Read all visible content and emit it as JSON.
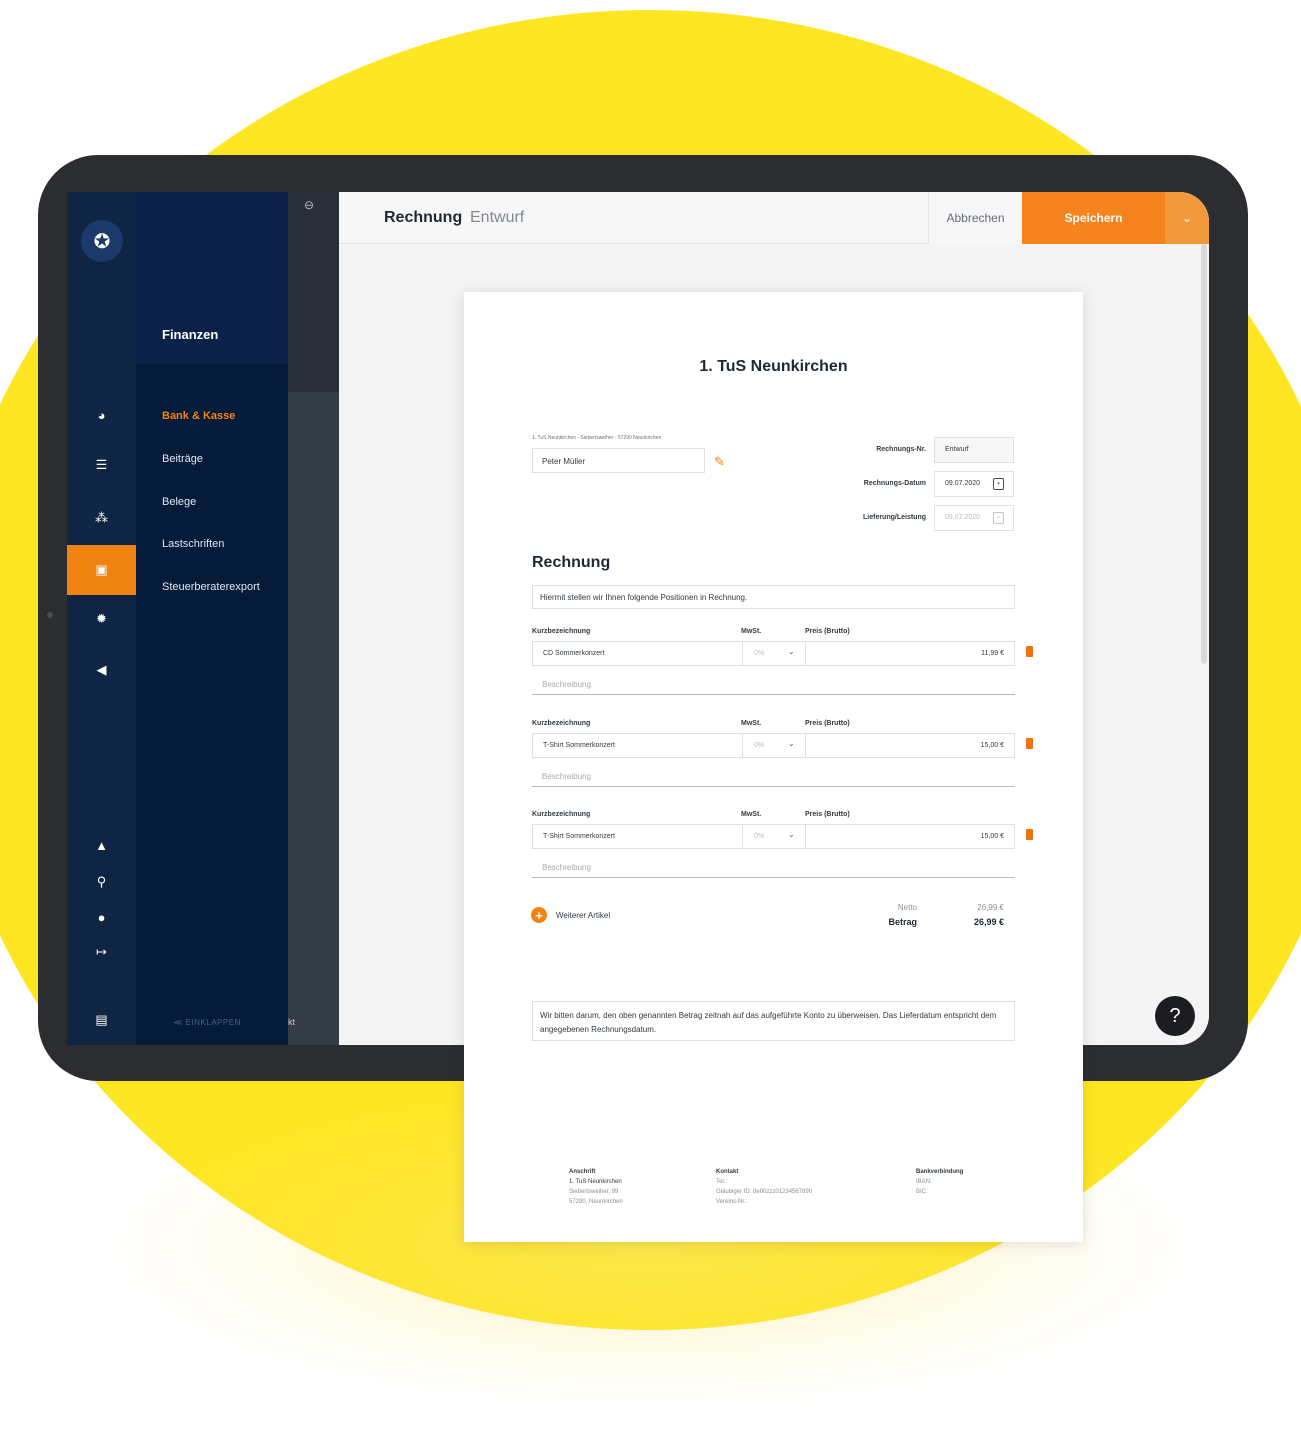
{
  "header": {
    "title": "Rechnung",
    "subtitle": "Entwurf",
    "cancel": "Abbrechen",
    "save": "Speichern",
    "save_menu": "⌄"
  },
  "rail": {
    "logo": "✪",
    "icons": [
      "dashboard-icon",
      "list-icon",
      "sitemap-icon",
      "bank-icon",
      "settings-icon",
      "megaphone-icon",
      "bell-icon",
      "search-icon",
      "info-icon",
      "logout-icon",
      "chat-icon"
    ]
  },
  "nav": {
    "section": "Finanzen",
    "items": [
      {
        "label": "Bank & Kasse",
        "active": true
      },
      {
        "label": "Beiträge"
      },
      {
        "label": "Belege"
      },
      {
        "label": "Lastschriften"
      },
      {
        "label": "Steuerberaterexport"
      }
    ],
    "collapse": "≪ EINKLAPPEN",
    "strip_text": "kt"
  },
  "invoice": {
    "club": "1. TuS Neunkirchen",
    "sender_line": "1. TuS Neunkirchen - Siebertsweiher - 57290 Neunkirchen",
    "recipient": "Peter Müller",
    "meta": {
      "number_label": "Rechnungs-Nr.",
      "number_value": "Entwurf",
      "date_label": "Rechnungs-Datum",
      "date_value": "09.07.2020",
      "delivery_label": "Lieferung/Leistung",
      "delivery_value": "09.07.2020"
    },
    "heading": "Rechnung",
    "intro": "Hiermit stellen wir Ihnen folgende Positionen in Rechnung.",
    "columns": {
      "name": "Kurzbezeichnung",
      "tax": "MwSt.",
      "price": "Preis (Brutto)"
    },
    "items": [
      {
        "name": "CD Sommerkonzert",
        "tax": "0%",
        "price": "11,99 €",
        "desc": "Beschreibung"
      },
      {
        "name": "T-Shirt Sommerkonzert",
        "tax": "0%",
        "price": "15,00 €",
        "desc": "Beschreibung"
      },
      {
        "name": "T-Shirt Sommerkonzert",
        "tax": "0%",
        "price": "15,00 €",
        "desc": "Beschreibung"
      }
    ],
    "add_label": "Weiterer Artikel",
    "totals": {
      "net_label": "Netto",
      "net_value": "26,99 €",
      "amount_label": "Betrag",
      "amount_value": "26,99 €"
    },
    "note": "Wir bitten darum, den oben genannten Betrag zeitnah auf das aufgeführte Konto zu überweisen. Das Lieferdatum entspricht dem angegebenen Rechnungsdatum.",
    "footer": {
      "address": {
        "title": "Anschrift",
        "line1": "1. TuS Neunkirchen",
        "line2": "Siebertsweiher, 99",
        "line3": "57290, Neunkirchen"
      },
      "contact": {
        "title": "Kontakt",
        "line1": "Tel.:",
        "line2": "Gläubiger ID: de00zzz01234567890",
        "line3": "Vereins-Nr.:"
      },
      "bank": {
        "title": "Bankverbindung",
        "line1": "IBAN:",
        "line2": "BIC:"
      }
    }
  },
  "help": "?",
  "colors": {
    "accent": "#f5841f",
    "sidebar": "#061a3a",
    "rail": "#102443",
    "background_circle": "#ffe623"
  }
}
